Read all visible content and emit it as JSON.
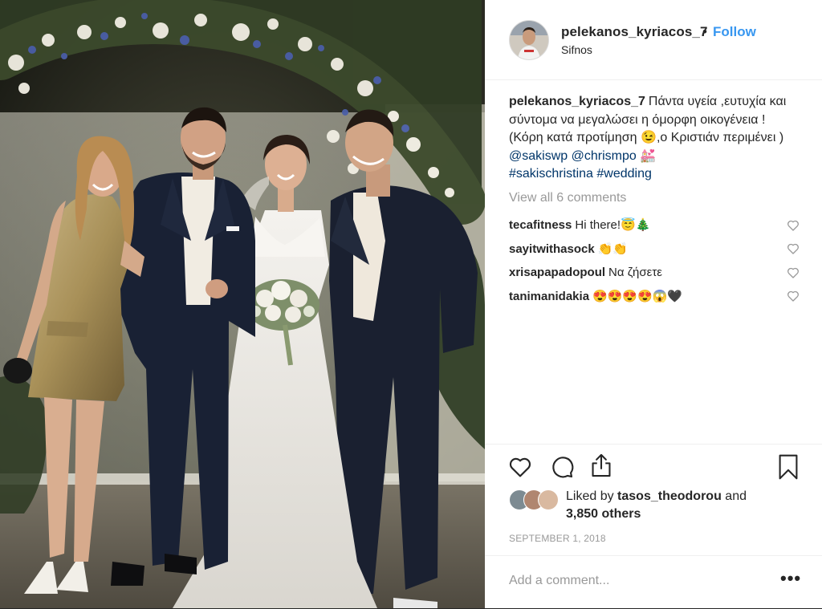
{
  "post": {
    "username": "pelekanos_kyriacos_7",
    "separator": "•",
    "follow_label": "Follow",
    "location": "Sifnos",
    "caption": {
      "username": "pelekanos_kyriacos_7",
      "text": "Πάντα υγεία ,ευτυχία και σύντομα να μεγαλώσει η όμορφη οικογένεια ! (Κόρη κατά προτίμηση 😉,ο Κριστιάν περιμένει )",
      "mentions": [
        "@sakiswp",
        "@chrismpo"
      ],
      "emoji": "💒",
      "hashtags": [
        "#sakischristina",
        "#wedding"
      ]
    },
    "view_all_comments": "View all 6 comments",
    "comments": [
      {
        "user": "tecafitness",
        "text": "Hi there!😇🎄"
      },
      {
        "user": "sayitwithasock",
        "text": "👏👏"
      },
      {
        "user": "xrisapapadopoul",
        "text": "Να ζήσετε"
      },
      {
        "user": "tanimanidakia",
        "text": "😍😍😍😍😱🖤"
      }
    ],
    "liked_by": {
      "prefix": "Liked by",
      "user": "tasos_theodorou",
      "middle": "and",
      "others": "3,850 others"
    },
    "date": "SEPTEMBER 1, 2018",
    "add_comment_placeholder": "Add a comment...",
    "more_label": "•••",
    "icons": {
      "like": "heart-icon",
      "comment": "comment-bubble-icon",
      "share": "share-icon",
      "save": "bookmark-icon",
      "comment_like": "heart-outline-icon"
    },
    "colors": {
      "link_blue": "#3897f0",
      "hashtag": "#003569",
      "muted": "#999999",
      "text": "#262626"
    }
  }
}
